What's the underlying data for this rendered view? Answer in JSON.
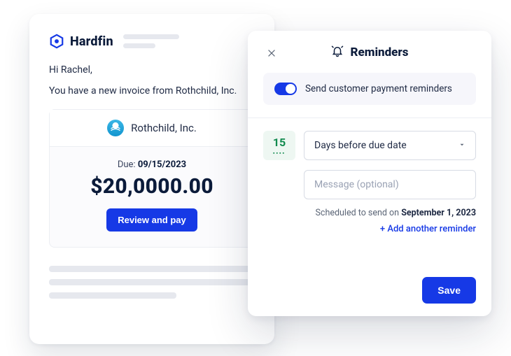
{
  "brand": {
    "name": "Hardfin"
  },
  "email": {
    "greeting": "Hi Rachel,",
    "lead": "You have a new invoice from Rothchild, Inc.",
    "company": "Rothchild, Inc.",
    "due_label": "Due:",
    "due_date": "09/15/2023",
    "amount": "$20,0000.00",
    "cta": "Review and pay"
  },
  "modal": {
    "title": "Reminders",
    "toggle_label": "Send customer payment reminders",
    "days_value": "15",
    "select_label": "Days before due date",
    "message_placeholder": "Message (optional)",
    "scheduled_prefix": "Scheduled to send on",
    "scheduled_date": "September 1, 2023",
    "add_link": "+ Add another reminder",
    "save": "Save"
  }
}
